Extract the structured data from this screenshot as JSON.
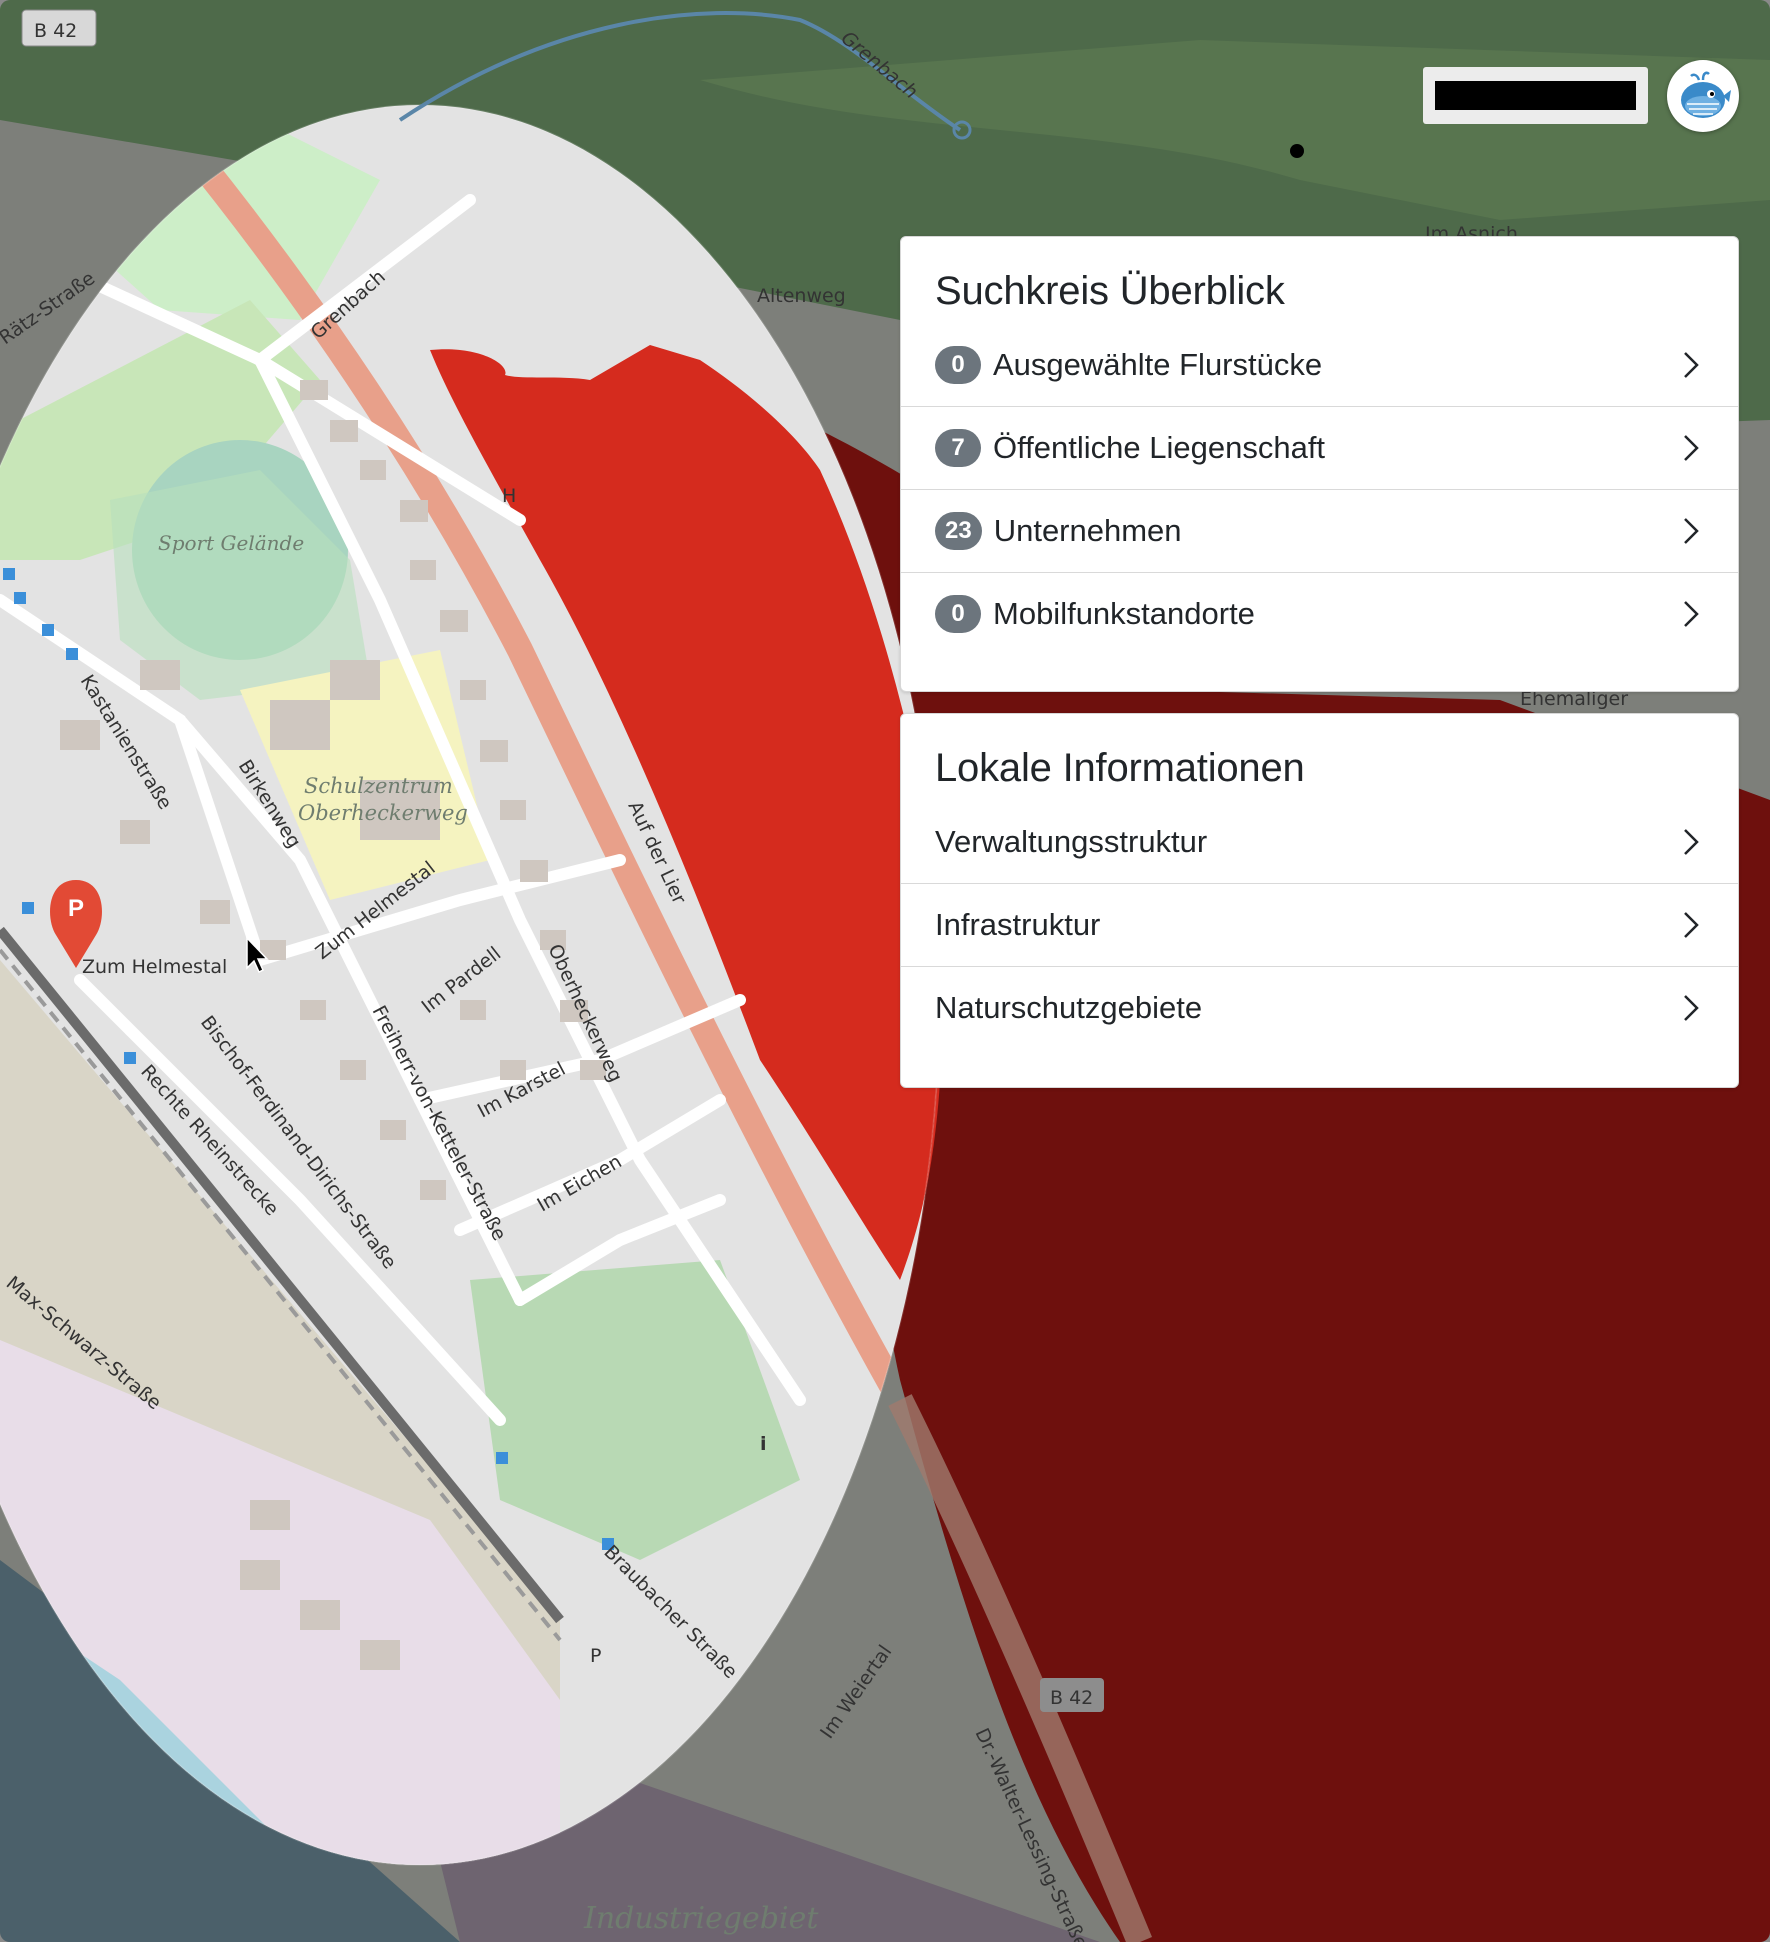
{
  "map": {
    "road_labels": {
      "b42_top": "B 42",
      "b42_bottom": "B 42",
      "grenbach_creek": "Grenbach",
      "grenbach_street": "Grenbach",
      "altenweg": "Altenweg",
      "im_asnich": "Im Asnich",
      "ehemaliger": "Ehemaliger",
      "ratz_strasse": "Rätz-Straße",
      "sport_gelaende": "Sport Gelände",
      "schulzentrum_1": "Schulzentrum",
      "schulzentrum_2": "Oberheckerweg",
      "kastanienstrasse": "Kastanienstraße",
      "birkenweg": "Birkenweg",
      "zum_helmestal_1": "Zum Helmestal",
      "zum_helmestal_2": "Zum Helmestal",
      "im_pardell": "Im Pardell",
      "oberheckerweg": "Oberheckerweg",
      "auf_der_lier": "Auf der Lier",
      "freiherr": "Freiherr-von-Ketteler-Straße",
      "im_karstel": "Im Karstel",
      "im_eichen": "Im Eichen",
      "bischof": "Bischof-Ferdinand-Dirichs-Straße",
      "rechte_rheinstrecke": "Rechte Rheinstrecke",
      "max_schwarz": "Max-Schwarz-Straße",
      "braubacher": "Braubacher Straße",
      "im_weiertal": "Im Weiertal",
      "dr_walter": "Dr.-Walter-Lessing-Straße",
      "industriegebiet": "Industriegebiet",
      "h_label": "H",
      "parking": "P",
      "info": "i"
    },
    "parking_marker_label": "P"
  },
  "colors": {
    "selection_red": "#d52b1e",
    "dark_red": "#6e100d",
    "road_orange": "#e8a08a",
    "badge_gray": "#6c757d"
  },
  "search_overview": {
    "title": "Suchkreis Überblick",
    "items": [
      {
        "count": "0",
        "label": "Ausgewählte Flurstücke"
      },
      {
        "count": "7",
        "label": "Öffentliche Liegenschaft"
      },
      {
        "count": "23",
        "label": "Unternehmen"
      },
      {
        "count": "0",
        "label": "Mobilfunkstandorte"
      }
    ]
  },
  "local_info": {
    "title": "Lokale Informationen",
    "items": [
      {
        "label": "Verwaltungsstruktur"
      },
      {
        "label": "Infrastruktur"
      },
      {
        "label": "Naturschutzgebiete"
      }
    ]
  },
  "icons": {
    "logo": "whale-logo-icon",
    "chevron": "chevron-right-icon",
    "cursor": "mouse-cursor-icon"
  }
}
